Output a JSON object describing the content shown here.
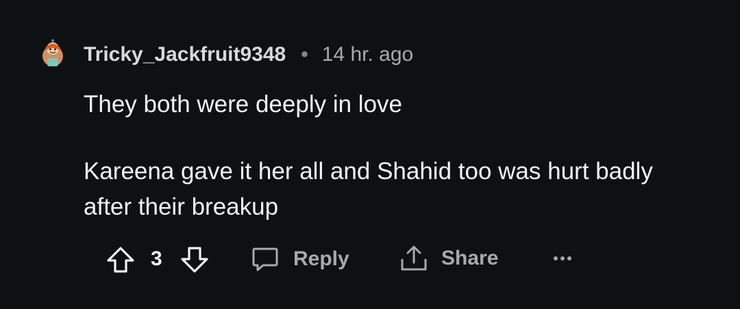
{
  "comment": {
    "username": "Tricky_Jackfruit9348",
    "separator": "•",
    "time_ago": "14 hr. ago",
    "paragraphs": [
      "They both were deeply in love",
      "Kareena gave it her all and Shahid too was hurt badly after their breakup"
    ]
  },
  "actions": {
    "score": "3",
    "reply_label": "Reply",
    "share_label": "Share"
  },
  "icons": {
    "avatar": "snoo-avatar-icon",
    "upvote": "arrow-up-icon",
    "downvote": "arrow-down-icon",
    "reply": "speech-bubble-icon",
    "share": "share-icon",
    "more": "more-dots-icon"
  },
  "colors": {
    "background": "#0e1113",
    "text": "#f2f4f5",
    "muted": "#a5abad"
  }
}
